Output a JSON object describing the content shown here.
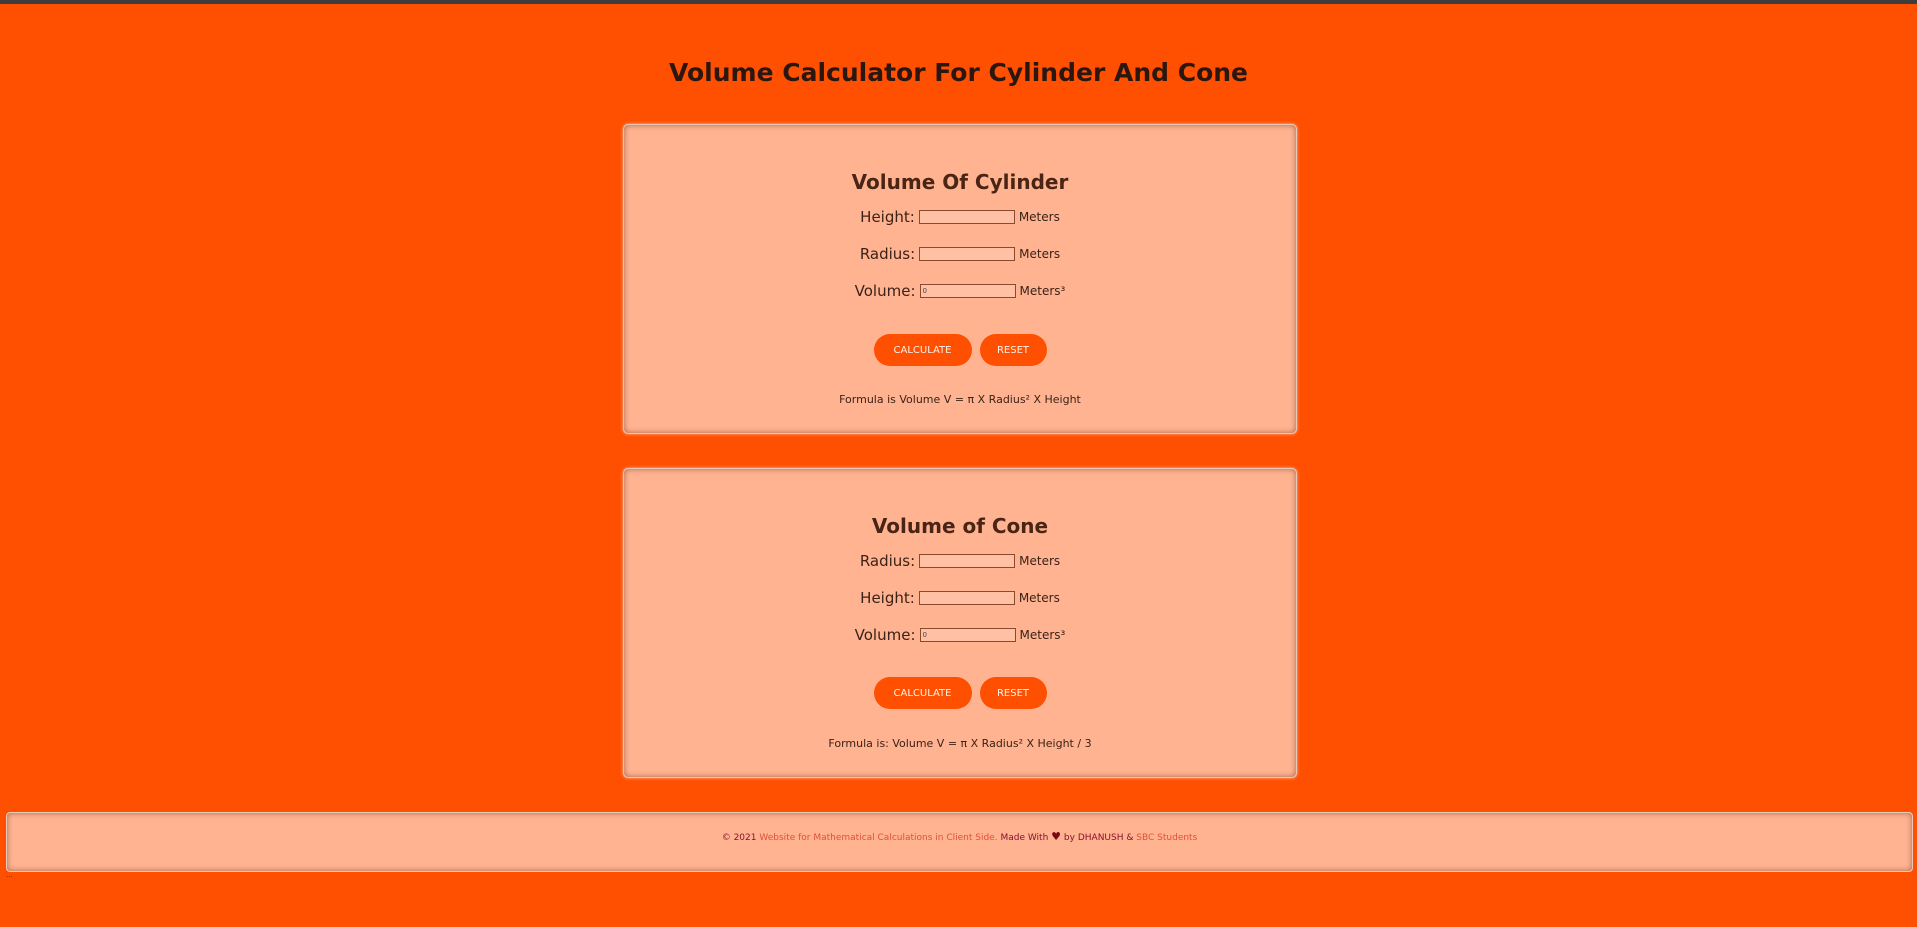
{
  "page_title": "Volume Calculator For Cylinder And Cone",
  "cylinder": {
    "title": "Volume Of Cylinder",
    "fields": [
      {
        "label": "Height:",
        "value": "",
        "unit": "Meters"
      },
      {
        "label": "Radius:",
        "value": "",
        "unit": "Meters"
      },
      {
        "label": "Volume:",
        "value": "0",
        "unit": "Meters³"
      }
    ],
    "calculate_label": "CALCULATE",
    "reset_label": "RESET",
    "formula": "Formula is Volume V = π X Radius² X Height"
  },
  "cone": {
    "title": "Volume of Cone",
    "fields": [
      {
        "label": "Radius:",
        "value": "",
        "unit": "Meters"
      },
      {
        "label": "Height:",
        "value": "",
        "unit": "Meters"
      },
      {
        "label": "Volume:",
        "value": "0",
        "unit": "Meters³"
      }
    ],
    "calculate_label": "CALCULATE",
    "reset_label": "RESET",
    "formula": "Formula is: Volume V = π X Radius² X Height / 3"
  },
  "footer": {
    "copyright": "© 2021",
    "site_link": "Website for Mathematical Calculations in Client Side.",
    "made_with": "Made With",
    "heart": "♥",
    "by": "by",
    "author": "DHANUSH",
    "amp": "&",
    "group_link": "SBC Students"
  },
  "colors": {
    "background": "#ff4f00",
    "card": "#ffb391",
    "button": "#ff4f00"
  }
}
